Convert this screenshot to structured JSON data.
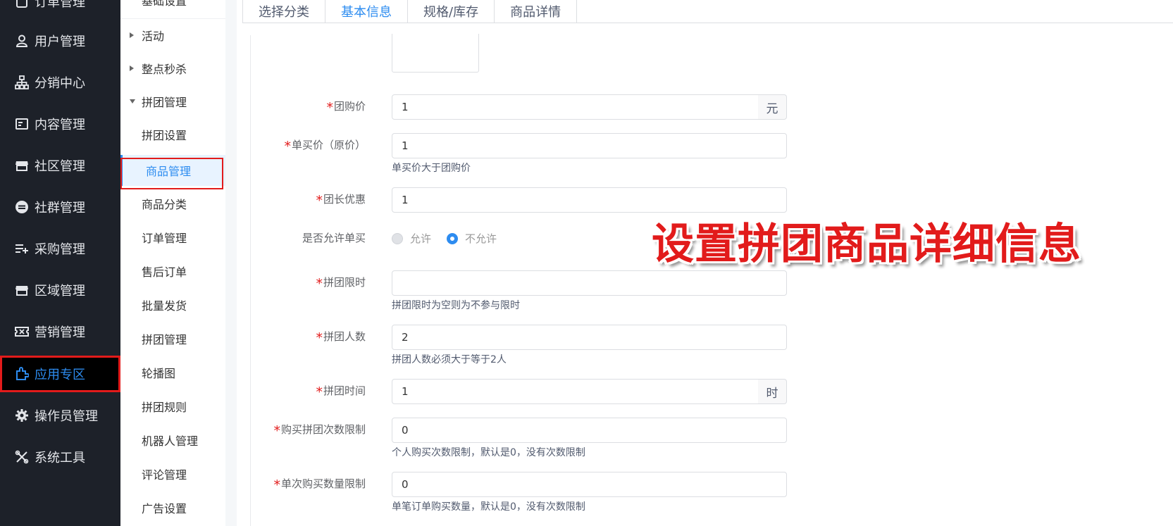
{
  "sidebar": {
    "items": [
      {
        "label": "订单管理",
        "icon": "order-icon"
      },
      {
        "label": "用户管理",
        "icon": "user-icon"
      },
      {
        "label": "分销中心",
        "icon": "sitemap-icon"
      },
      {
        "label": "内容管理",
        "icon": "document-icon"
      },
      {
        "label": "社区管理",
        "icon": "store-icon"
      },
      {
        "label": "社群管理",
        "icon": "minus-circle-icon"
      },
      {
        "label": "采购管理",
        "icon": "list-add-icon"
      },
      {
        "label": "区域管理",
        "icon": "store-icon"
      },
      {
        "label": "营销管理",
        "icon": "ticket-icon"
      },
      {
        "label": "应用专区",
        "icon": "puzzle-icon"
      },
      {
        "label": "操作员管理",
        "icon": "gear-icon"
      },
      {
        "label": "系统工具",
        "icon": "tools-icon"
      }
    ],
    "active_color": "#2d8cf0"
  },
  "submenu": {
    "top_partial": "基础设置",
    "items": [
      {
        "label": "活动"
      },
      {
        "label": "整点秒杀"
      },
      {
        "label": "拼团管理"
      },
      {
        "label": "拼团设置"
      },
      {
        "label": "商品管理"
      },
      {
        "label": "商品分类"
      },
      {
        "label": "订单管理"
      },
      {
        "label": "售后订单"
      },
      {
        "label": "批量发货"
      },
      {
        "label": "拼团管理"
      },
      {
        "label": "轮播图"
      },
      {
        "label": "拼团规则"
      },
      {
        "label": "机器人管理"
      },
      {
        "label": "评论管理"
      },
      {
        "label": "广告设置"
      }
    ]
  },
  "tabs": [
    "选择分类",
    "基本信息",
    "规格/库存",
    "商品详情"
  ],
  "form": {
    "group_price": {
      "label": "团购价",
      "value": "1",
      "addon": "元"
    },
    "single_price": {
      "label": "单买价（原价）",
      "value": "1",
      "hint": "单买价大于团购价"
    },
    "leader_discount": {
      "label": "团长优惠",
      "value": "1"
    },
    "allow_single": {
      "label": "是否允许单买",
      "options": [
        "允许",
        "不允许"
      ],
      "selected": "不允许"
    },
    "time_limit": {
      "label": "拼团限时",
      "value": "",
      "hint": "拼团限时为空则为不参与限时"
    },
    "group_size": {
      "label": "拼团人数",
      "value": "2",
      "hint": "拼团人数必须大于等于2人"
    },
    "group_time": {
      "label": "拼团时间",
      "value": "1",
      "addon": "时"
    },
    "buy_times_limit": {
      "label": "购买拼团次数限制",
      "value": "0",
      "hint": "个人购买次数限制，默认是0，没有次数限制"
    },
    "per_order_limit": {
      "label": "单次购买数量限制",
      "value": "0",
      "hint": "单笔订单购买数量，默认是0，没有次数限制"
    }
  },
  "overlay": {
    "caption": "设置拼团商品详细信息",
    "color": "#e21b1b"
  }
}
